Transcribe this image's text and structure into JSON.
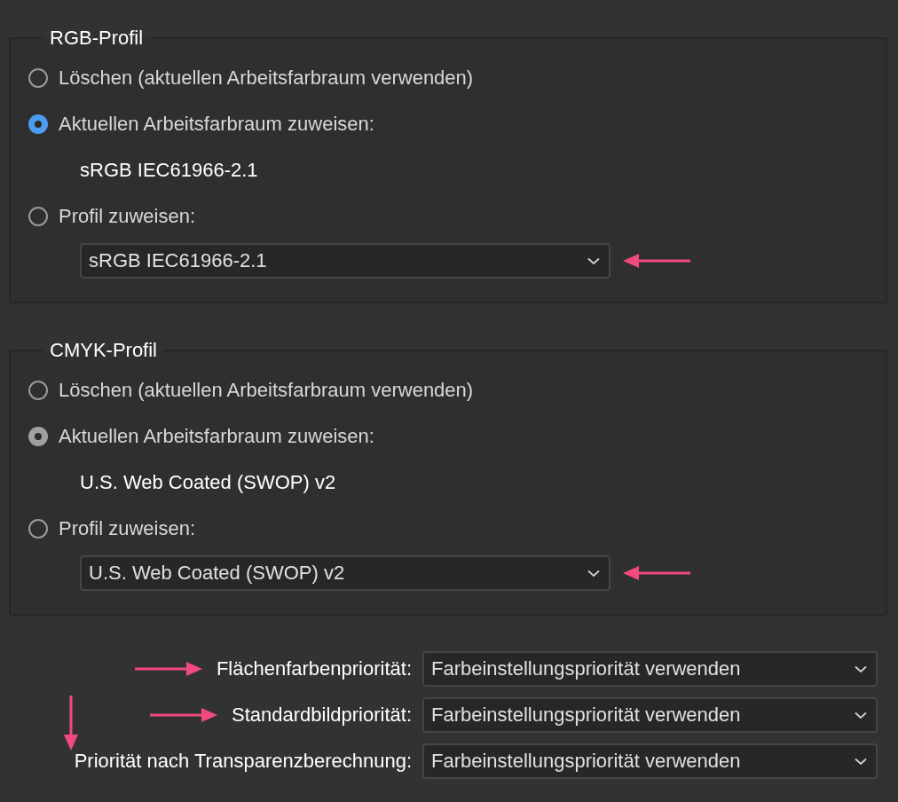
{
  "groups": [
    {
      "title": "RGB-Profil",
      "color": "#4c9df2",
      "options": [
        {
          "label": "Löschen (aktuellen Arbeitsfarbraum verwenden)",
          "selected": false
        },
        {
          "label": "Aktuellen Arbeitsfarbraum zuweisen:",
          "selected": true
        },
        {
          "label": "Profil zuweisen:",
          "selected": false
        }
      ],
      "current_profile": "sRGB IEC61966-2.1",
      "dropdown": {
        "value": "sRGB IEC61966-2.1",
        "pointer_arrow": true
      }
    },
    {
      "title": "CMYK-Profil",
      "color": "#a0a0a0",
      "options": [
        {
          "label": "Löschen (aktuellen Arbeitsfarbraum verwenden)",
          "selected": false
        },
        {
          "label": "Aktuellen Arbeitsfarbraum zuweisen:",
          "selected": true
        },
        {
          "label": "Profil zuweisen:",
          "selected": false
        }
      ],
      "current_profile": "U.S. Web Coated (SWOP) v2",
      "dropdown": {
        "value": "U.S. Web Coated (SWOP) v2",
        "pointer_arrow": true
      }
    }
  ],
  "priorities": {
    "down_arrow": true,
    "rows": [
      {
        "label": "Flächenfarbenpriorität:",
        "value": "Farbeinstellungspriorität verwenden",
        "pointer_arrow": true
      },
      {
        "label": "Standardbildpriorität:",
        "value": "Farbeinstellungspriorität verwenden",
        "pointer_arrow": true
      },
      {
        "label": "Priorität nach Transparenzberechnung:",
        "value": "Farbeinstellungspriorität verwenden",
        "pointer_arrow": false
      }
    ]
  }
}
